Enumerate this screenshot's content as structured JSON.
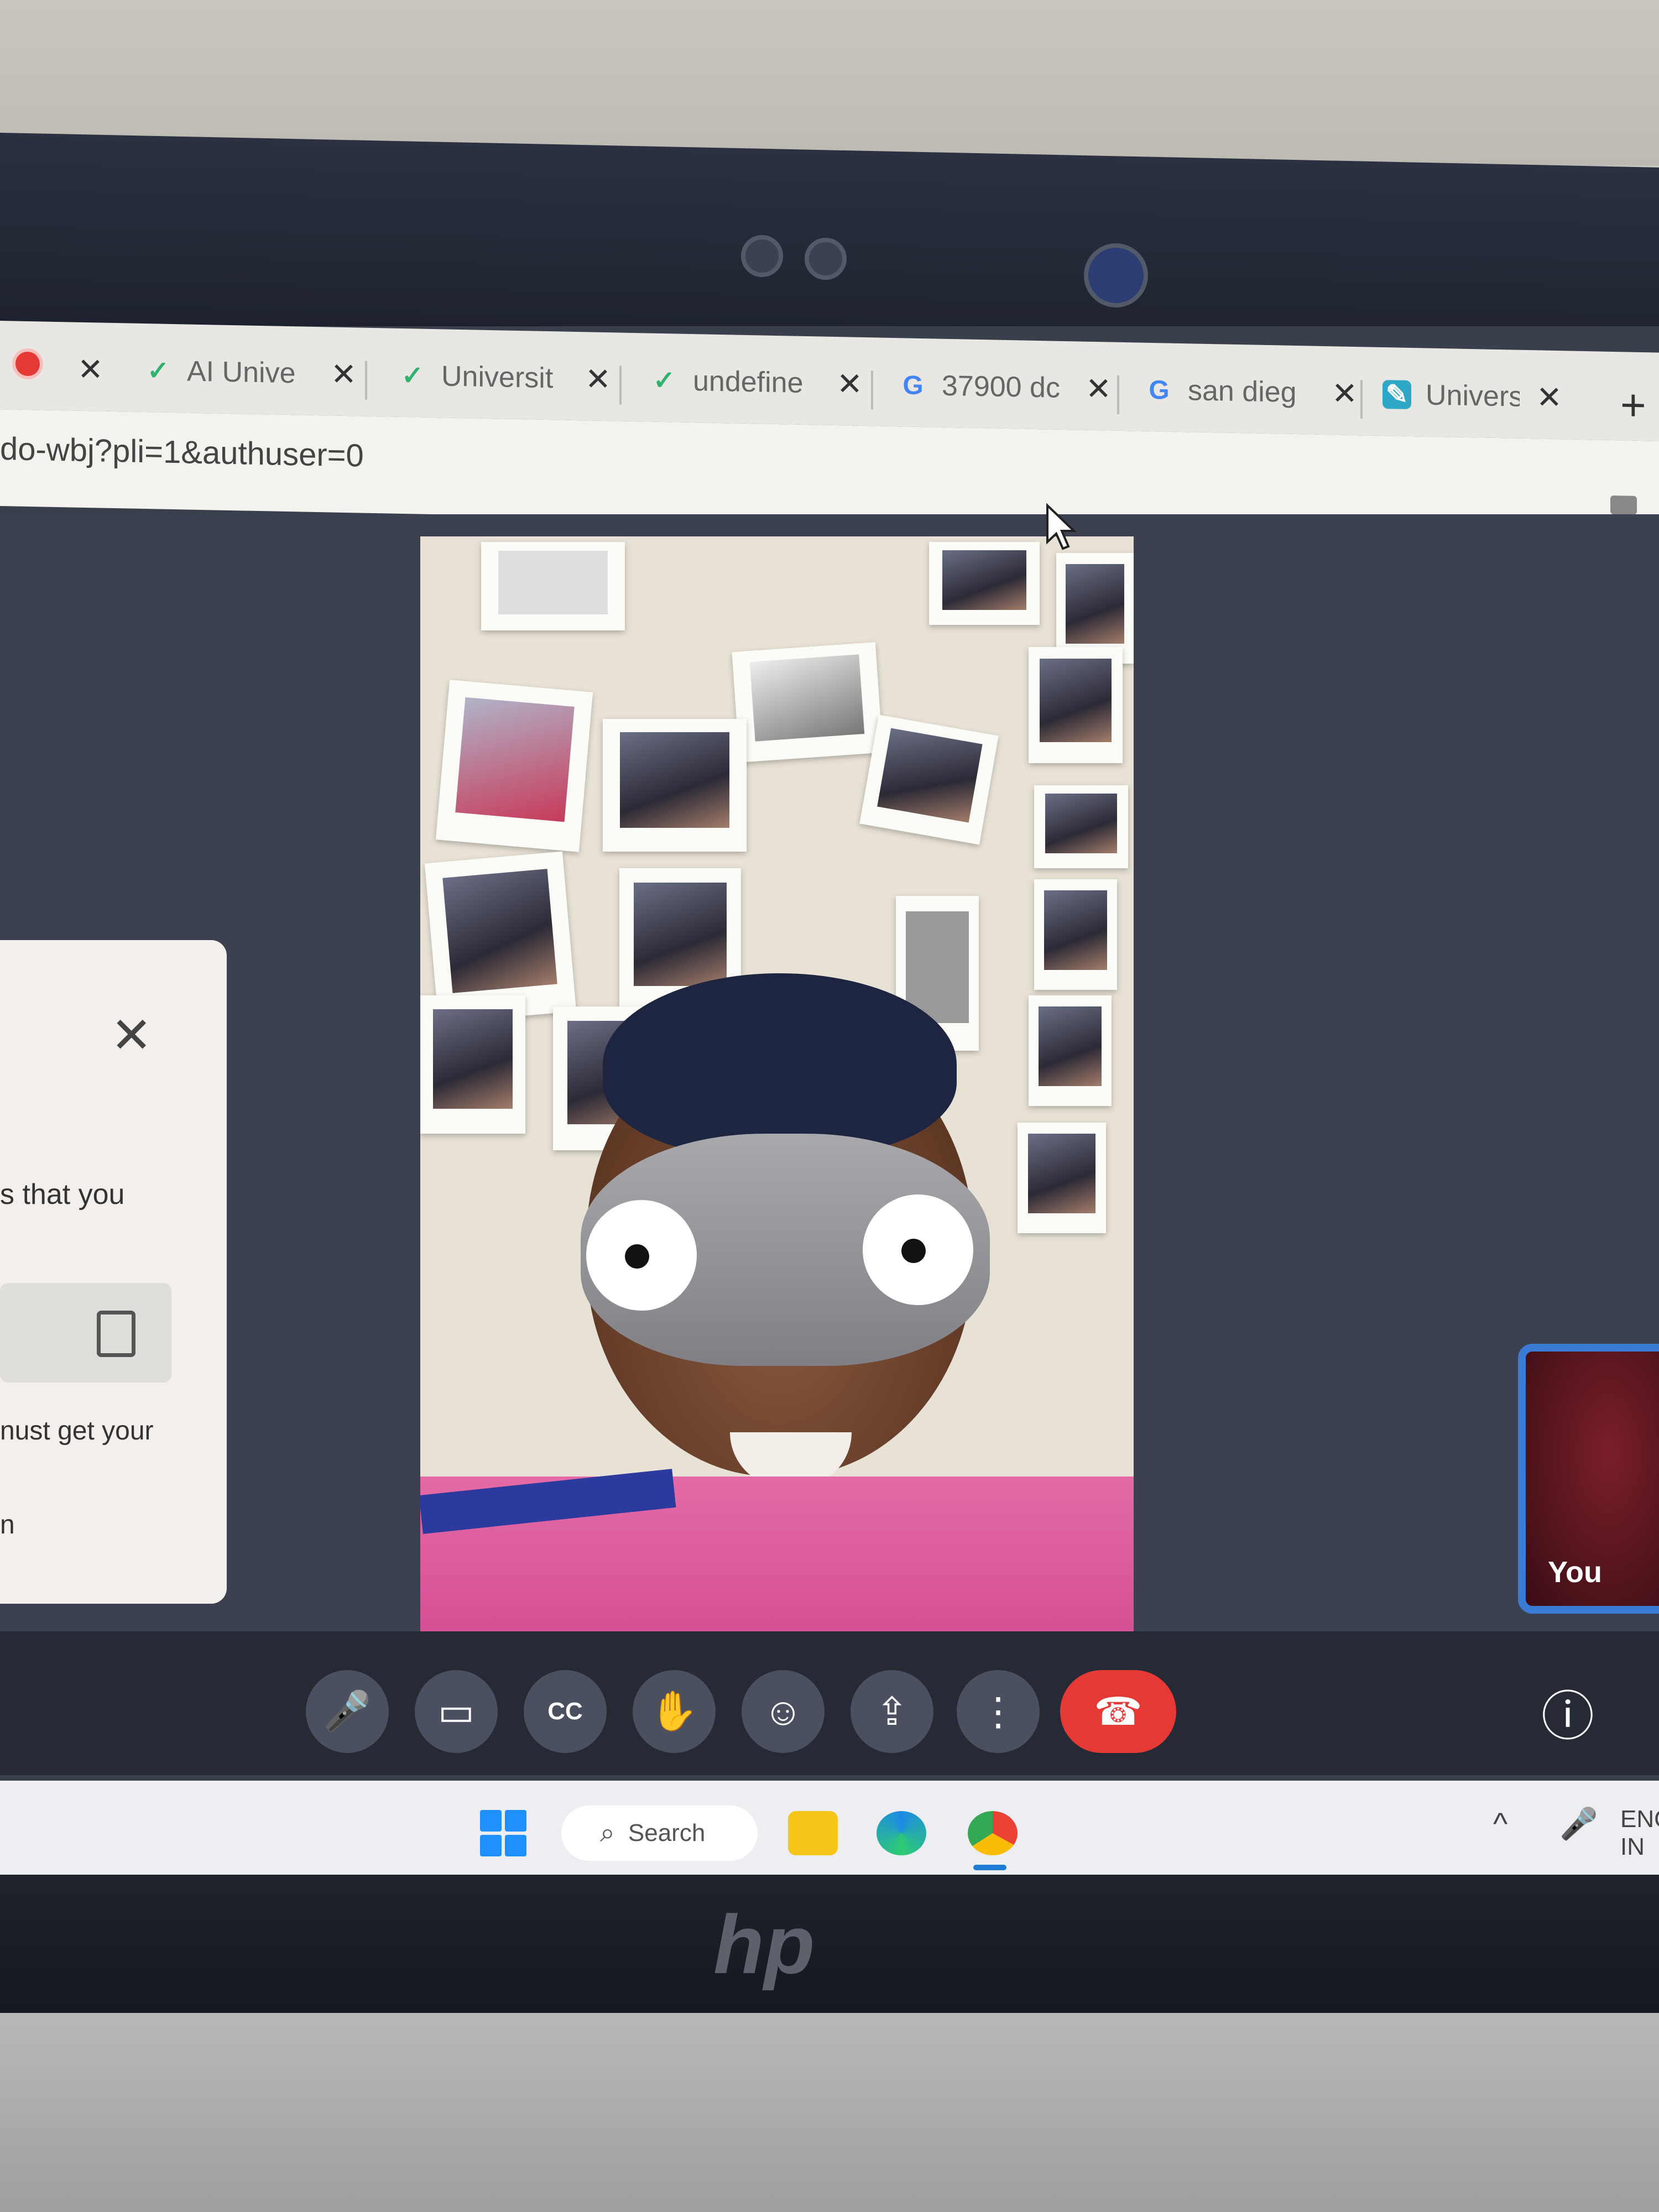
{
  "browser": {
    "tabs": [
      {
        "title": "AI Unive",
        "favicon": "v-icon"
      },
      {
        "title": "Universit",
        "favicon": "v-icon"
      },
      {
        "title": "undefine",
        "favicon": "v-icon"
      },
      {
        "title": "37900 dc",
        "favicon": "google-icon"
      },
      {
        "title": "san dieg",
        "favicon": "google-icon"
      },
      {
        "title": "Universi",
        "favicon": "pen-icon"
      }
    ],
    "new_tab": "+",
    "url": "do-wbj?pli=1&authuser=0"
  },
  "side_panel": {
    "close": "✕",
    "line1": "s that you",
    "line2": "nust get your",
    "line3": "n"
  },
  "self_tile": {
    "label": "You"
  },
  "controls": {
    "mic": "🎤",
    "camera": "▭",
    "captions": "CC",
    "raise_hand": "✋",
    "emoji": "☺",
    "present": "⇪",
    "more": "⋮",
    "end": "☎",
    "info": "ⓘ"
  },
  "taskbar": {
    "search_label": "Search",
    "tray_lang_1": "ENG",
    "tray_lang_2": "IN"
  },
  "brand": "hp",
  "colors": {
    "end_call": "#e53935",
    "self_border": "#3a7bd5",
    "windows_blue": "#1e90ff"
  }
}
